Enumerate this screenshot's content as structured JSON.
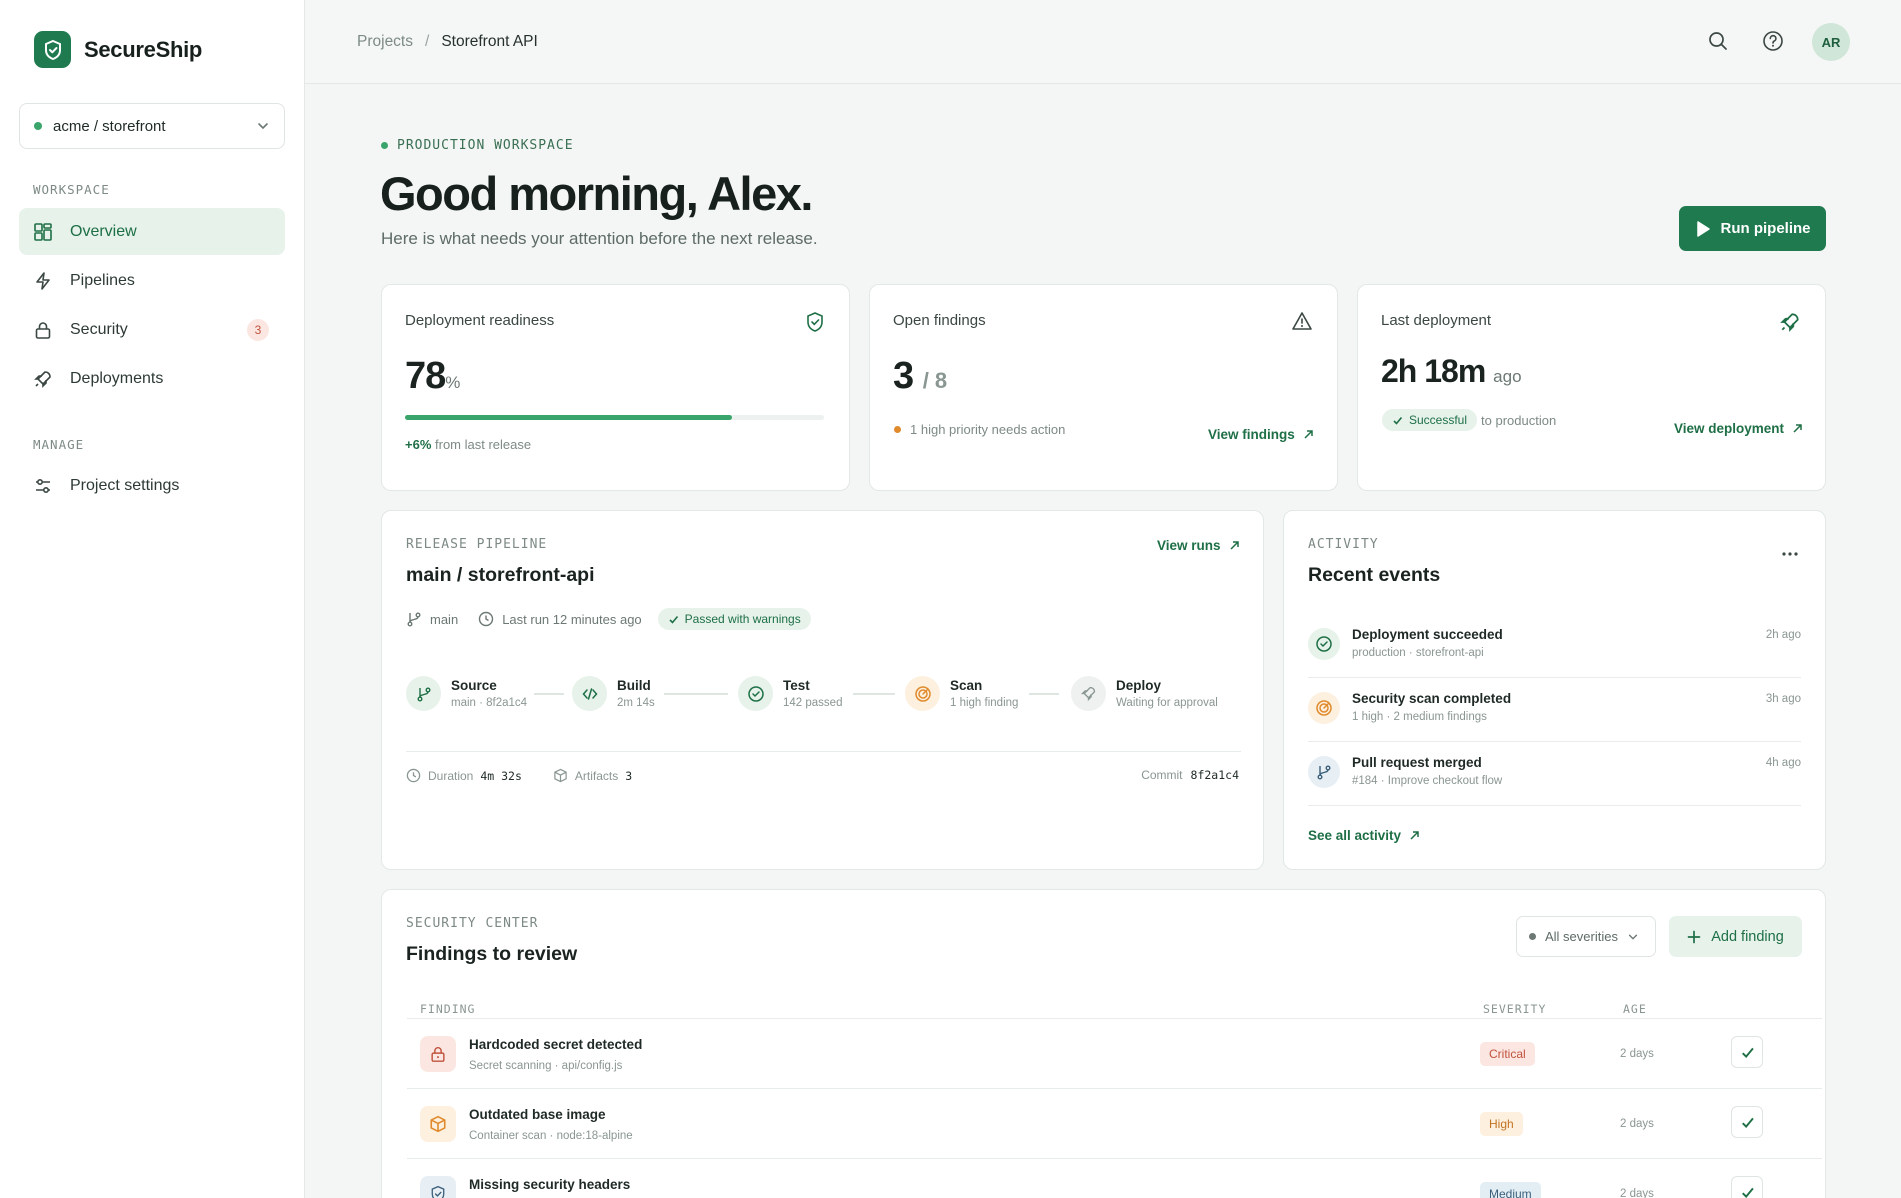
{
  "app": {
    "name": "SecureShip"
  },
  "project_selector": {
    "label": "acme / storefront"
  },
  "sidebar": {
    "workspace_label": "WORKSPACE",
    "items": [
      {
        "label": "Overview"
      },
      {
        "label": "Pipelines"
      },
      {
        "label": "Security",
        "badge": "3"
      },
      {
        "label": "Deployments"
      }
    ],
    "manage_label": "MANAGE",
    "manage_items": [
      {
        "label": "Project settings"
      }
    ]
  },
  "breadcrumb": {
    "parent": "Projects",
    "separator": "/",
    "current": "Storefront API"
  },
  "user": {
    "initials": "AR"
  },
  "header": {
    "eyebrow": "PRODUCTION WORKSPACE",
    "greeting": "Good morning, Alex.",
    "subtitle": "Here is what needs your attention before the next release.",
    "run_button": "Run pipeline"
  },
  "stats": {
    "readiness": {
      "title": "Deployment readiness",
      "value": "78",
      "unit": "%",
      "progress_pct": 78,
      "delta": "+6%",
      "delta_text": "from last release"
    },
    "findings": {
      "title": "Open findings",
      "value": "3",
      "total": "/ 8",
      "note": "1 high priority needs action",
      "link": "View findings"
    },
    "last_deploy": {
      "title": "Last deployment",
      "value": "2h 18m",
      "suffix": "ago",
      "status": "Successful",
      "target": "to production",
      "link": "View deployment"
    }
  },
  "pipeline": {
    "eyebrow": "RELEASE PIPELINE",
    "title": "main / storefront-api",
    "link": "View runs",
    "branch": "main",
    "last_run": "Last run 12 minutes ago",
    "status": "Passed with warnings",
    "stages": [
      {
        "name": "Source",
        "sub": "main · 8f2a1c4"
      },
      {
        "name": "Build",
        "sub": "2m 14s"
      },
      {
        "name": "Test",
        "sub": "142 passed"
      },
      {
        "name": "Scan",
        "sub": "1 high finding"
      },
      {
        "name": "Deploy",
        "sub": "Waiting for approval"
      }
    ],
    "duration_label": "Duration",
    "duration": "4m 32s",
    "artifacts_label": "Artifacts",
    "artifacts": "3",
    "commit_label": "Commit",
    "commit": "8f2a1c4"
  },
  "activity": {
    "eyebrow": "ACTIVITY",
    "title": "Recent events",
    "events": [
      {
        "title": "Deployment succeeded",
        "sub": "production · storefront-api",
        "time": "2h ago"
      },
      {
        "title": "Security scan completed",
        "sub": "1 high · 2 medium findings",
        "time": "3h ago"
      },
      {
        "title": "Pull request merged",
        "sub": "#184 · Improve checkout flow",
        "time": "4h ago"
      }
    ],
    "link": "See all activity"
  },
  "security": {
    "eyebrow": "SECURITY CENTER",
    "title": "Findings to review",
    "filter": "All severities",
    "add_button": "Add finding",
    "columns": {
      "finding": "FINDING",
      "severity": "SEVERITY",
      "age": "AGE"
    },
    "rows": [
      {
        "title": "Hardcoded secret detected",
        "sub": "Secret scanning · api/config.js",
        "severity": "Critical",
        "age": "2 days"
      },
      {
        "title": "Outdated base image",
        "sub": "Container scan · node:18-alpine",
        "severity": "High",
        "age": "2 days"
      },
      {
        "title": "Missing security headers",
        "sub": "",
        "severity": "Medium",
        "age": "2 days"
      }
    ]
  },
  "colors": {
    "accent": "#1f7a4f",
    "success": "#3aa56a",
    "warning": "#e08a2c",
    "danger": "#c0533c"
  }
}
